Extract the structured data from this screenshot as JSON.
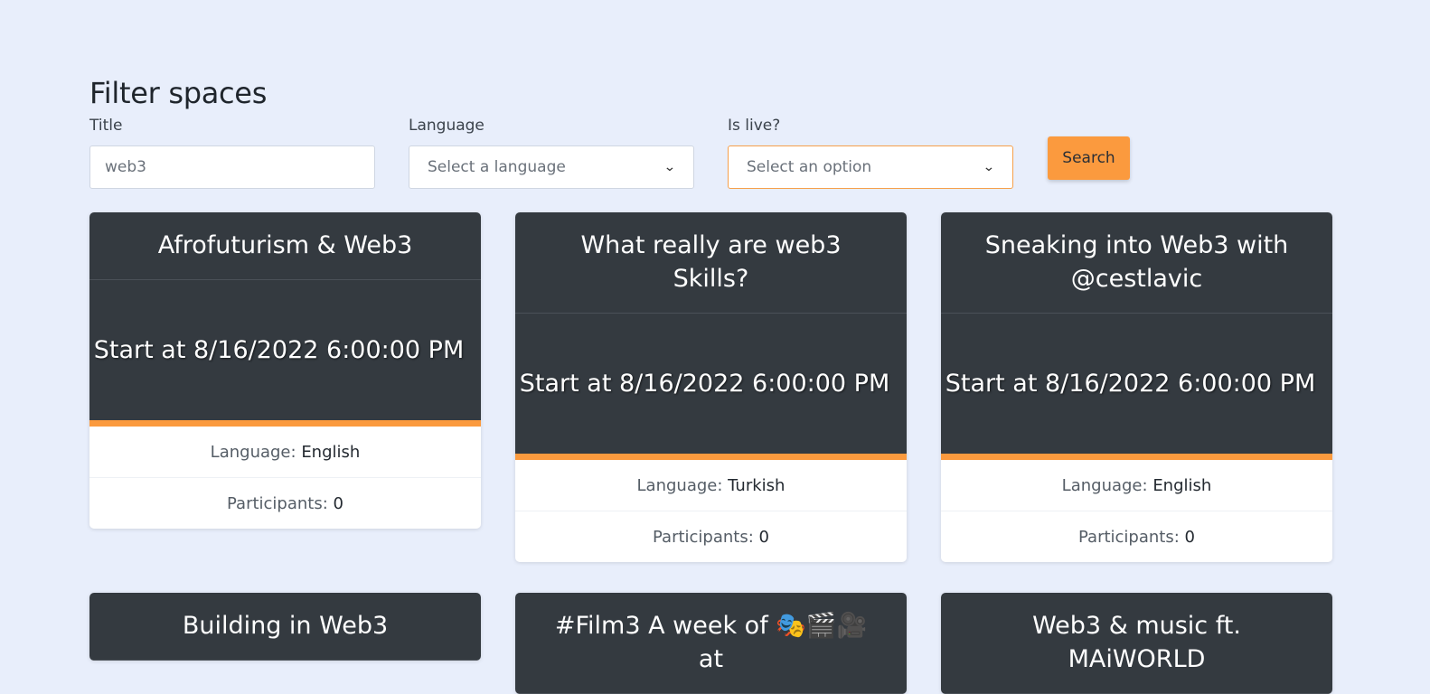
{
  "page": {
    "title": "Filter spaces"
  },
  "filters": {
    "title_label": "Title",
    "title_value": "web3",
    "language_label": "Language",
    "language_value": "Select a language",
    "is_live_label": "Is live?",
    "is_live_value": "Select an option",
    "search_label": "Search"
  },
  "cards": [
    {
      "title": "Afrofuturism & Web3",
      "start": "Start at 8/16/2022 6:00:00 PM",
      "language_label": "Language:",
      "language": "English",
      "participants_label": "Participants:",
      "participants": "0"
    },
    {
      "title": "What really are web3 Skills?",
      "start": "Start at 8/16/2022 6:00:00 PM",
      "language_label": "Language:",
      "language": "Turkish",
      "participants_label": "Participants:",
      "participants": "0"
    },
    {
      "title": "Sneaking into Web3 with @cestlavic",
      "start": "Start at 8/16/2022 6:00:00 PM",
      "language_label": "Language:",
      "language": "English",
      "participants_label": "Participants:",
      "participants": "0"
    },
    {
      "title": "Building in Web3"
    },
    {
      "title": "#Film3 A week of 🎭🎬🎥 at"
    },
    {
      "title": "Web3 & music ft. MAiWORLD"
    }
  ],
  "icons": {
    "select_chevron": "chevron-down-icon"
  },
  "colors": {
    "background": "#e8eefb",
    "card_header": "#343a40",
    "accent": "#fb9a3e"
  }
}
